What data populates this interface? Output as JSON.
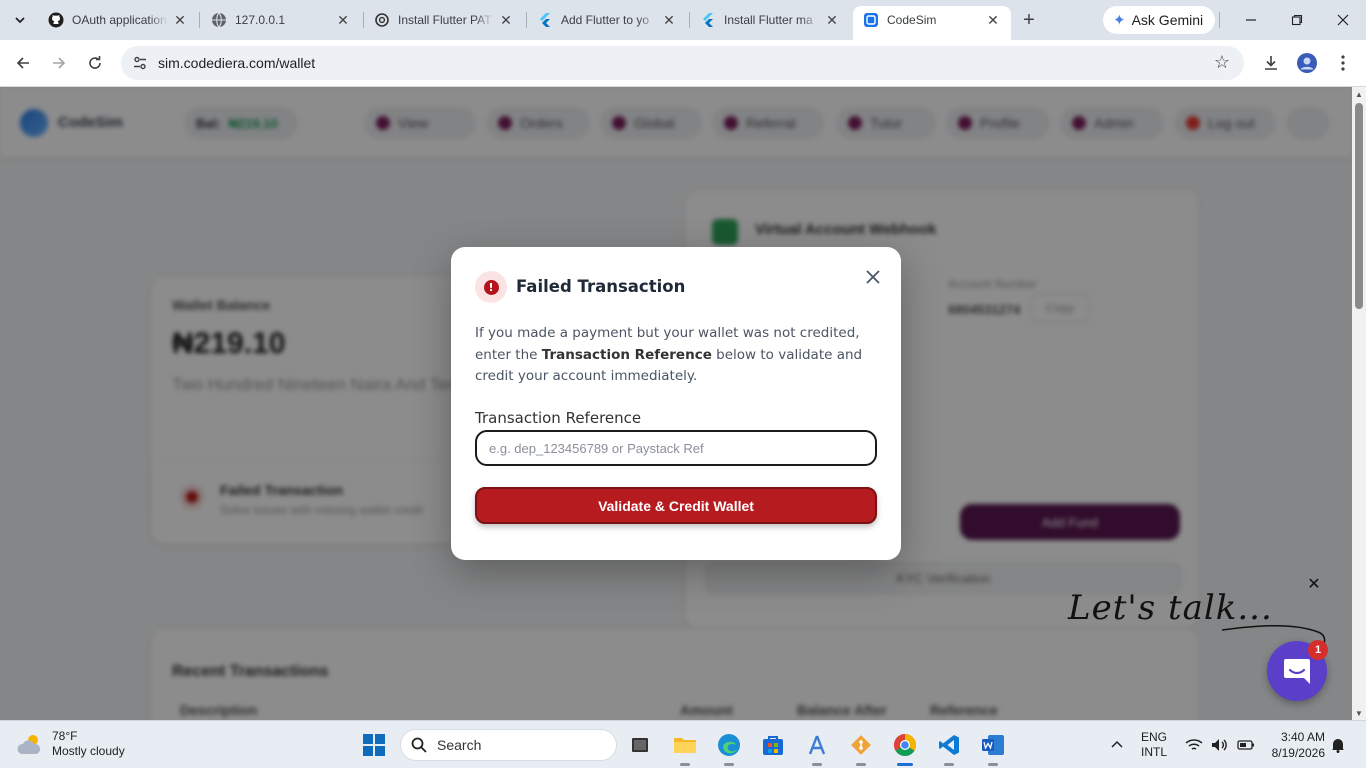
{
  "browser": {
    "tabs": [
      {
        "title": "OAuth application",
        "favicon": "github-icon"
      },
      {
        "title": "127.0.0.1",
        "favicon": "globe-icon"
      },
      {
        "title": "Install Flutter PAT",
        "favicon": "openai-icon"
      },
      {
        "title": "Add Flutter to yo",
        "favicon": "flutter-icon"
      },
      {
        "title": "Install Flutter ma",
        "favicon": "flutter-icon"
      },
      {
        "title": "CodeSim",
        "favicon": "codesim-icon",
        "active": true
      }
    ],
    "ask_gemini": "Ask Gemini",
    "url": "sim.codediera.com/wallet"
  },
  "page": {
    "brand": "CodeSim",
    "balance_pill": {
      "label": "Bal:",
      "value": "₦219.10"
    },
    "nav": [
      "View",
      "Orders",
      "Global",
      "Referral",
      "Tutor",
      "Profile",
      "Admin",
      "Log out"
    ],
    "wallet": {
      "label": "Wallet Balance",
      "amount": "₦219.10",
      "words": "Two Hundred Nineteen Naira And Ten Kobo"
    },
    "failed_card": {
      "title": "Failed Transaction",
      "subtitle": "Solve issues with missing wallet credit"
    },
    "virtual_account": {
      "title": "Virtual Account Webhook",
      "acct_label": "Account Number",
      "acct_value": "6804531274",
      "copy": "Copy",
      "fund": "Add Fund",
      "kyc": "KYC Verification"
    },
    "recent": {
      "title": "Recent Transactions",
      "columns": [
        "Description",
        "Amount",
        "Balance After",
        "Reference"
      ]
    }
  },
  "modal": {
    "title": "Failed Transaction",
    "text_before": "If you made a payment but your wallet was not credited, enter the",
    "text_bold": "Transaction Reference",
    "text_after": "below to validate and credit your account immediately.",
    "field_label": "Transaction Reference",
    "placeholder": "e.g. dep_123456789 or Paystack Ref",
    "button": "Validate & Credit Wallet"
  },
  "chat": {
    "tagline": "Let's talk...",
    "badge": "1"
  },
  "taskbar": {
    "weather_temp": "78°F",
    "weather_desc": "Mostly cloudy",
    "search": "Search",
    "lang1": "ENG",
    "lang2": "INTL",
    "time": "3:40 AM",
    "date": "8/19/2026"
  },
  "colors": {
    "accent_red": "#b51b1f",
    "brand_purple": "#5a1650",
    "chat_purple": "#5b3fc9"
  }
}
